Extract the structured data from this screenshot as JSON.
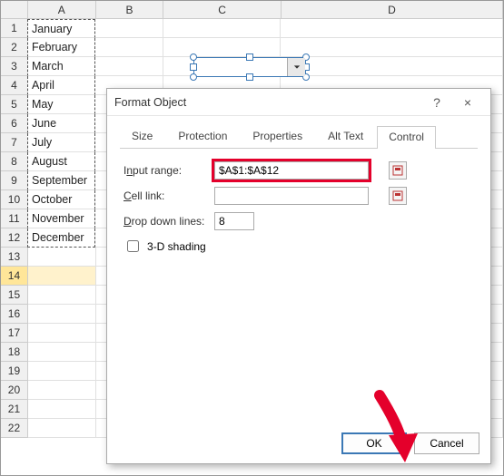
{
  "columns": [
    "A",
    "B",
    "C",
    "D"
  ],
  "months": [
    "January",
    "February",
    "March",
    "April",
    "May",
    "June",
    "July",
    "August",
    "September",
    "October",
    "November",
    "December"
  ],
  "total_rows": 22,
  "selected_row": 14,
  "dialog": {
    "title": "Format Object",
    "help_label": "?",
    "close_label": "×",
    "tabs": [
      "Size",
      "Protection",
      "Properties",
      "Alt Text",
      "Control"
    ],
    "active_tab": 4,
    "fields": {
      "input_range_label_pre": "I",
      "input_range_label_u": "n",
      "input_range_label_post": "put range:",
      "input_range_value": "$A$1:$A$12",
      "cell_link_label_pre": "",
      "cell_link_label_u": "C",
      "cell_link_label_post": "ell link:",
      "cell_link_value": "",
      "dropdown_lines_label_pre": "",
      "dropdown_lines_label_u": "D",
      "dropdown_lines_label_post": "rop down lines:",
      "dropdown_lines_value": "8",
      "shading_label_u": "3",
      "shading_label_post": "-D shading"
    },
    "buttons": {
      "ok": "OK",
      "cancel": "Cancel"
    }
  }
}
